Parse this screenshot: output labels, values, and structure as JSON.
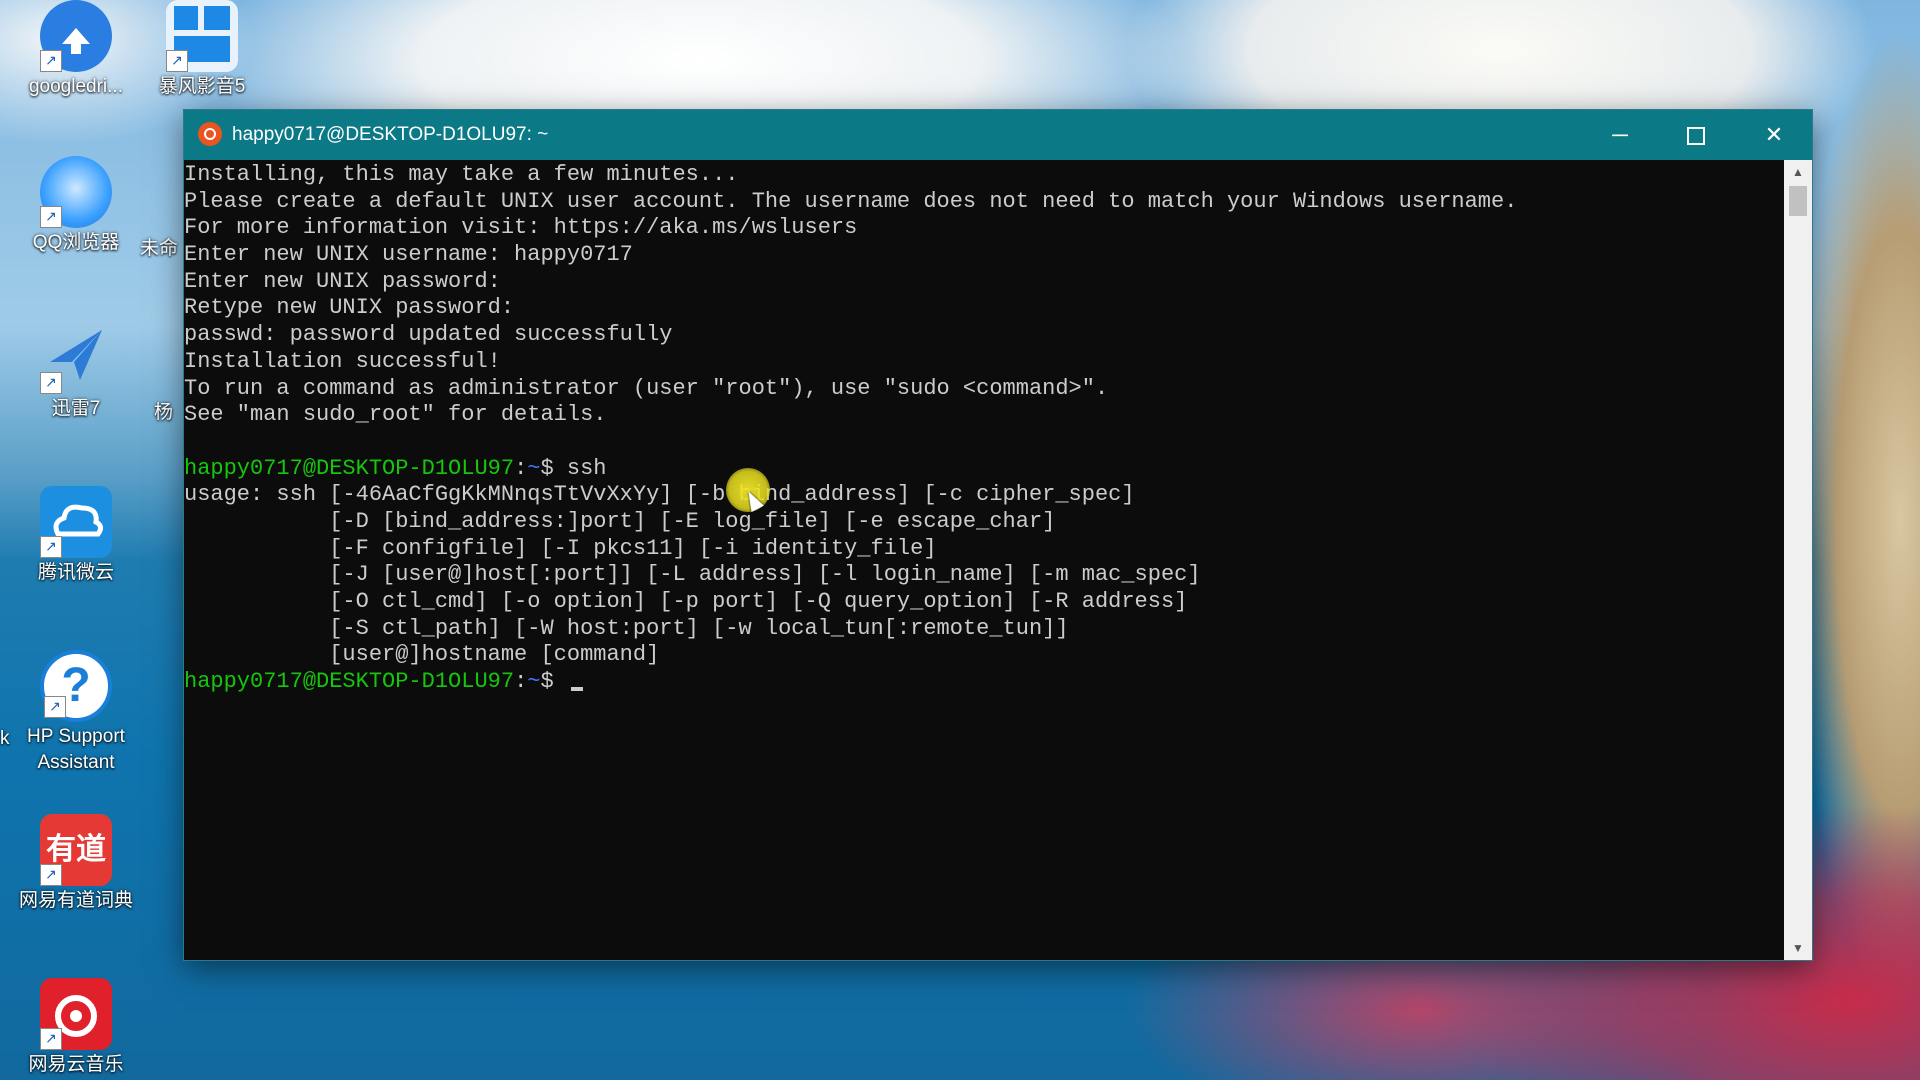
{
  "desktop": {
    "icons": [
      {
        "label": "googledri...",
        "color": "#2a7de1"
      },
      {
        "label": "暴风影音5",
        "color": "#1e88e5"
      },
      {
        "label": "QQ浏览器",
        "color": "#3aa0ff"
      },
      {
        "label": "迅雷7",
        "color": "#2e7bd6"
      },
      {
        "label": "腾讯微云",
        "color": "#1d8fe1"
      },
      {
        "label": "HP Support Assistant",
        "color": "#1a7fd8"
      },
      {
        "label": "网易有道词典",
        "color": "#e53935"
      },
      {
        "label": "网易云音乐",
        "color": "#e0202a"
      }
    ],
    "partial_labels": [
      "未命",
      "杨",
      "k"
    ]
  },
  "window": {
    "title": "happy0717@DESKTOP-D1OLU97: ~",
    "minimize": "─",
    "close": "✕"
  },
  "terminal": {
    "lines": [
      "Installing, this may take a few minutes...",
      "Please create a default UNIX user account. The username does not need to match your Windows username.",
      "For more information visit: https://aka.ms/wslusers",
      "Enter new UNIX username: happy0717",
      "Enter new UNIX password:",
      "Retype new UNIX password:",
      "passwd: password updated successfully",
      "Installation successful!",
      "To run a command as administrator (user \"root\"), use \"sudo <command>\".",
      "See \"man sudo_root\" for details.",
      ""
    ],
    "prompt1": {
      "user_host": "happy0717@DESKTOP-D1OLU97",
      "path": "~",
      "symbol": "$",
      "command": "ssh"
    },
    "usage_lines": [
      "usage: ssh [-46AaCfGgKkMNnqsTtVvXxYy] [-b bind_address] [-c cipher_spec]",
      "           [-D [bind_address:]port] [-E log_file] [-e escape_char]",
      "           [-F configfile] [-I pkcs11] [-i identity_file]",
      "           [-J [user@]host[:port]] [-L address] [-l login_name] [-m mac_spec]",
      "           [-O ctl_cmd] [-o option] [-p port] [-Q query_option] [-R address]",
      "           [-S ctl_path] [-W host:port] [-w local_tun[:remote_tun]]",
      "           [user@]hostname [command]"
    ],
    "prompt2": {
      "user_host": "happy0717@DESKTOP-D1OLU97",
      "path": "~",
      "symbol": "$",
      "command": ""
    },
    "colors": {
      "prompt": "#16c60c",
      "path": "#3b78ff",
      "text": "#cccccc",
      "background": "#0c0c0c",
      "titlebar": "#0c7a86"
    }
  }
}
